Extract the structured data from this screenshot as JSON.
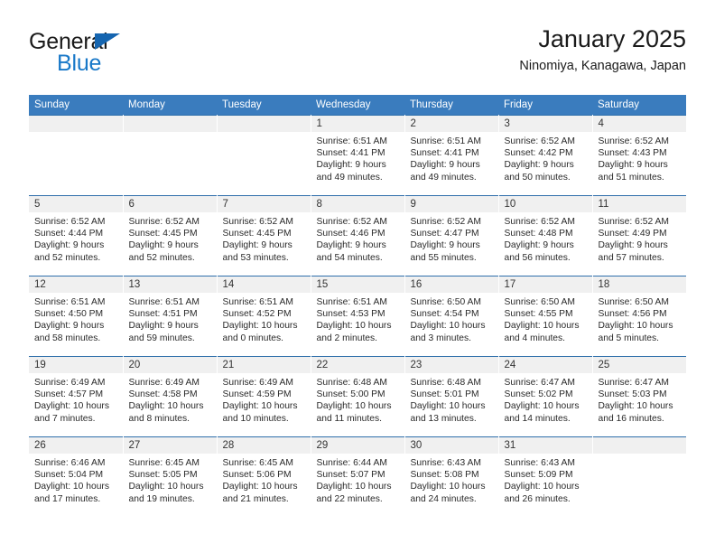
{
  "brand": {
    "name_top": "General",
    "name_bottom": "Blue",
    "accent_color": "#1878c8",
    "triangle_color": "#1565b0"
  },
  "header": {
    "title": "January 2025",
    "subtitle": "Ninomiya, Kanagawa, Japan"
  },
  "calendar": {
    "header_color": "#3a7cbe",
    "weekdays": [
      "Sunday",
      "Monday",
      "Tuesday",
      "Wednesday",
      "Thursday",
      "Friday",
      "Saturday"
    ],
    "weeks": [
      [
        {
          "day": "",
          "empty": true
        },
        {
          "day": "",
          "empty": true
        },
        {
          "day": "",
          "empty": true
        },
        {
          "day": "1",
          "sunrise": "Sunrise: 6:51 AM",
          "sunset": "Sunset: 4:41 PM",
          "daylight_1": "Daylight: 9 hours",
          "daylight_2": "and 49 minutes."
        },
        {
          "day": "2",
          "sunrise": "Sunrise: 6:51 AM",
          "sunset": "Sunset: 4:41 PM",
          "daylight_1": "Daylight: 9 hours",
          "daylight_2": "and 49 minutes."
        },
        {
          "day": "3",
          "sunrise": "Sunrise: 6:52 AM",
          "sunset": "Sunset: 4:42 PM",
          "daylight_1": "Daylight: 9 hours",
          "daylight_2": "and 50 minutes."
        },
        {
          "day": "4",
          "sunrise": "Sunrise: 6:52 AM",
          "sunset": "Sunset: 4:43 PM",
          "daylight_1": "Daylight: 9 hours",
          "daylight_2": "and 51 minutes."
        }
      ],
      [
        {
          "day": "5",
          "sunrise": "Sunrise: 6:52 AM",
          "sunset": "Sunset: 4:44 PM",
          "daylight_1": "Daylight: 9 hours",
          "daylight_2": "and 52 minutes."
        },
        {
          "day": "6",
          "sunrise": "Sunrise: 6:52 AM",
          "sunset": "Sunset: 4:45 PM",
          "daylight_1": "Daylight: 9 hours",
          "daylight_2": "and 52 minutes."
        },
        {
          "day": "7",
          "sunrise": "Sunrise: 6:52 AM",
          "sunset": "Sunset: 4:45 PM",
          "daylight_1": "Daylight: 9 hours",
          "daylight_2": "and 53 minutes."
        },
        {
          "day": "8",
          "sunrise": "Sunrise: 6:52 AM",
          "sunset": "Sunset: 4:46 PM",
          "daylight_1": "Daylight: 9 hours",
          "daylight_2": "and 54 minutes."
        },
        {
          "day": "9",
          "sunrise": "Sunrise: 6:52 AM",
          "sunset": "Sunset: 4:47 PM",
          "daylight_1": "Daylight: 9 hours",
          "daylight_2": "and 55 minutes."
        },
        {
          "day": "10",
          "sunrise": "Sunrise: 6:52 AM",
          "sunset": "Sunset: 4:48 PM",
          "daylight_1": "Daylight: 9 hours",
          "daylight_2": "and 56 minutes."
        },
        {
          "day": "11",
          "sunrise": "Sunrise: 6:52 AM",
          "sunset": "Sunset: 4:49 PM",
          "daylight_1": "Daylight: 9 hours",
          "daylight_2": "and 57 minutes."
        }
      ],
      [
        {
          "day": "12",
          "sunrise": "Sunrise: 6:51 AM",
          "sunset": "Sunset: 4:50 PM",
          "daylight_1": "Daylight: 9 hours",
          "daylight_2": "and 58 minutes."
        },
        {
          "day": "13",
          "sunrise": "Sunrise: 6:51 AM",
          "sunset": "Sunset: 4:51 PM",
          "daylight_1": "Daylight: 9 hours",
          "daylight_2": "and 59 minutes."
        },
        {
          "day": "14",
          "sunrise": "Sunrise: 6:51 AM",
          "sunset": "Sunset: 4:52 PM",
          "daylight_1": "Daylight: 10 hours",
          "daylight_2": "and 0 minutes."
        },
        {
          "day": "15",
          "sunrise": "Sunrise: 6:51 AM",
          "sunset": "Sunset: 4:53 PM",
          "daylight_1": "Daylight: 10 hours",
          "daylight_2": "and 2 minutes."
        },
        {
          "day": "16",
          "sunrise": "Sunrise: 6:50 AM",
          "sunset": "Sunset: 4:54 PM",
          "daylight_1": "Daylight: 10 hours",
          "daylight_2": "and 3 minutes."
        },
        {
          "day": "17",
          "sunrise": "Sunrise: 6:50 AM",
          "sunset": "Sunset: 4:55 PM",
          "daylight_1": "Daylight: 10 hours",
          "daylight_2": "and 4 minutes."
        },
        {
          "day": "18",
          "sunrise": "Sunrise: 6:50 AM",
          "sunset": "Sunset: 4:56 PM",
          "daylight_1": "Daylight: 10 hours",
          "daylight_2": "and 5 minutes."
        }
      ],
      [
        {
          "day": "19",
          "sunrise": "Sunrise: 6:49 AM",
          "sunset": "Sunset: 4:57 PM",
          "daylight_1": "Daylight: 10 hours",
          "daylight_2": "and 7 minutes."
        },
        {
          "day": "20",
          "sunrise": "Sunrise: 6:49 AM",
          "sunset": "Sunset: 4:58 PM",
          "daylight_1": "Daylight: 10 hours",
          "daylight_2": "and 8 minutes."
        },
        {
          "day": "21",
          "sunrise": "Sunrise: 6:49 AM",
          "sunset": "Sunset: 4:59 PM",
          "daylight_1": "Daylight: 10 hours",
          "daylight_2": "and 10 minutes."
        },
        {
          "day": "22",
          "sunrise": "Sunrise: 6:48 AM",
          "sunset": "Sunset: 5:00 PM",
          "daylight_1": "Daylight: 10 hours",
          "daylight_2": "and 11 minutes."
        },
        {
          "day": "23",
          "sunrise": "Sunrise: 6:48 AM",
          "sunset": "Sunset: 5:01 PM",
          "daylight_1": "Daylight: 10 hours",
          "daylight_2": "and 13 minutes."
        },
        {
          "day": "24",
          "sunrise": "Sunrise: 6:47 AM",
          "sunset": "Sunset: 5:02 PM",
          "daylight_1": "Daylight: 10 hours",
          "daylight_2": "and 14 minutes."
        },
        {
          "day": "25",
          "sunrise": "Sunrise: 6:47 AM",
          "sunset": "Sunset: 5:03 PM",
          "daylight_1": "Daylight: 10 hours",
          "daylight_2": "and 16 minutes."
        }
      ],
      [
        {
          "day": "26",
          "sunrise": "Sunrise: 6:46 AM",
          "sunset": "Sunset: 5:04 PM",
          "daylight_1": "Daylight: 10 hours",
          "daylight_2": "and 17 minutes."
        },
        {
          "day": "27",
          "sunrise": "Sunrise: 6:45 AM",
          "sunset": "Sunset: 5:05 PM",
          "daylight_1": "Daylight: 10 hours",
          "daylight_2": "and 19 minutes."
        },
        {
          "day": "28",
          "sunrise": "Sunrise: 6:45 AM",
          "sunset": "Sunset: 5:06 PM",
          "daylight_1": "Daylight: 10 hours",
          "daylight_2": "and 21 minutes."
        },
        {
          "day": "29",
          "sunrise": "Sunrise: 6:44 AM",
          "sunset": "Sunset: 5:07 PM",
          "daylight_1": "Daylight: 10 hours",
          "daylight_2": "and 22 minutes."
        },
        {
          "day": "30",
          "sunrise": "Sunrise: 6:43 AM",
          "sunset": "Sunset: 5:08 PM",
          "daylight_1": "Daylight: 10 hours",
          "daylight_2": "and 24 minutes."
        },
        {
          "day": "31",
          "sunrise": "Sunrise: 6:43 AM",
          "sunset": "Sunset: 5:09 PM",
          "daylight_1": "Daylight: 10 hours",
          "daylight_2": "and 26 minutes."
        },
        {
          "day": "",
          "empty": true
        }
      ]
    ]
  }
}
